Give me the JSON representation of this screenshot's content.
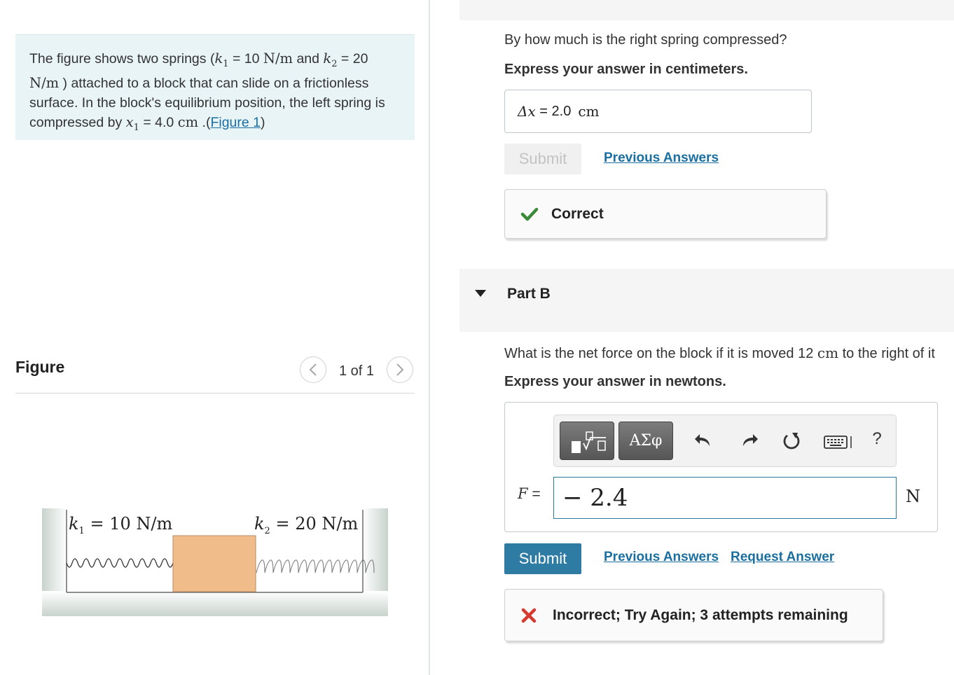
{
  "problem": {
    "intro": "The figure shows two springs (",
    "k1_sym": "k",
    "k1_sub": "1",
    "k1_eq": " = 10 ",
    "k1_unit": "N/m",
    "mid1": " and ",
    "k2_sym": "k",
    "k2_sub": "2",
    "k2_eq": " = ",
    "k2_val": "20 ",
    "k2_unit": "N/m",
    "text2": " ) attached to a block that can slide on a frictionless surface. In the block's equilibrium position, the left spring is compressed by ",
    "x1_sym": "x",
    "x1_sub": "1",
    "x1_eq": " = 4.0 ",
    "x1_unit": "cm",
    "text3": " .(",
    "figure_link": "Figure 1",
    "close": ")"
  },
  "figure": {
    "title": "Figure",
    "counter": "1 of 1",
    "prev_icon": "chevron-left-icon",
    "next_icon": "chevron-right-icon",
    "k1_label": "k",
    "k1_sub": "1",
    "k1_value": " = 10 N/m",
    "k2_label": "k",
    "k2_sub": "2",
    "k2_value": " = 20 N/m",
    "block_color": "#f0bc8a"
  },
  "partA": {
    "question": "By how much is the right spring compressed?",
    "instruction": "Express your answer in centimeters.",
    "answer_symbol": "Δx",
    "answer_eq": " = ",
    "answer_value": "2.0",
    "answer_unit": "cm",
    "submit_label": "Submit",
    "previous_answers": "Previous Answers",
    "feedback": "Correct",
    "feedback_icon": "check-icon",
    "feedback_color": "#3a8a3a"
  },
  "partB": {
    "title": "Part B",
    "question_prefix": "What is the net force on the block if it is moved 12 ",
    "question_unit": "cm",
    "question_suffix": " to the right of it",
    "instruction": "Express your answer in newtons.",
    "toolbar": {
      "greek_label": "ΑΣφ",
      "templates_icon": "template-sqrt-icon",
      "undo_icon": "undo-icon",
      "redo_icon": "redo-icon",
      "reset_icon": "reset-icon",
      "keyboard_icon": "keyboard-icon",
      "help_label": "?"
    },
    "variable": "F",
    "eq": " = ",
    "input_value": "− 2.4",
    "unit": "N",
    "submit_label": "Submit",
    "previous_answers": "Previous Answers",
    "request_answer": "Request Answer",
    "feedback": "Incorrect; Try Again; 3 attempts remaining",
    "feedback_icon": "x-mark-icon",
    "feedback_color": "#d63a2e",
    "accent": "#2e7ca3"
  }
}
